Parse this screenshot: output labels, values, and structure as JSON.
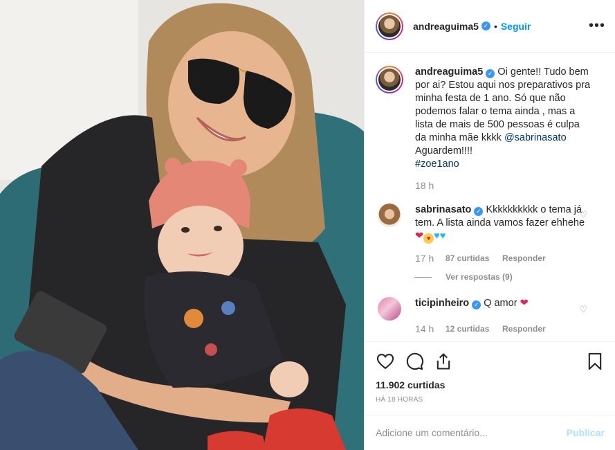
{
  "post": {
    "username": "andreaguima5",
    "verified_icon": "verified-badge-icon",
    "dot": "•",
    "follow_label": "Seguir",
    "more_label": "•••"
  },
  "caption": {
    "username": "andreaguima5",
    "text": "Oi gente!! Tudo bem por ai? Estou aqui nos preparativos pra minha festa de 1 ano. Só que não podemos falar o tema ainda , mas a lista de mais de 500 pessoas é culpa da minha mãe kkkk",
    "mention": "@sabrinasato",
    "text2": "Aguardem!!!!",
    "hashtag": "#zoe1ano",
    "time": "18 h"
  },
  "comments": [
    {
      "username": "sabrinasato",
      "text": "Kkkkkkkkkk o tema já tem. A lista ainda vamos fazer ehhehe",
      "emoji": [
        "❤",
        "😍",
        "💙",
        "💙"
      ],
      "time": "17 h",
      "likes": "87 curtidas",
      "reply_label": "Responder",
      "view_replies": "Ver respostas (9)"
    },
    {
      "username": "ticipinheiro",
      "text": "Q amor",
      "emoji": [
        "❤"
      ],
      "time": "14 h",
      "likes": "12 curtidas",
      "reply_label": "Responder"
    }
  ],
  "actions": {
    "like_icon": "heart-icon",
    "comment_icon": "comment-icon",
    "share_icon": "share-icon",
    "save_icon": "bookmark-icon",
    "likes_total": "11.902 curtidas",
    "ago": "HÁ 18 HORAS"
  },
  "comment_box": {
    "placeholder": "Adicione um comentário...",
    "post_label": "Publicar"
  },
  "colors": {
    "link": "#0095f6",
    "verified": "#3897f0",
    "muted": "#8e8e8e",
    "post_disabled": "#b2dffc"
  }
}
